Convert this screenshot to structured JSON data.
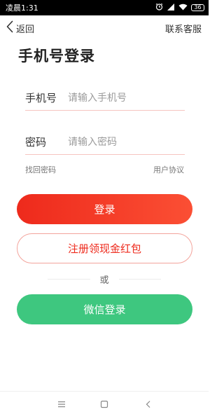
{
  "status_bar": {
    "time": "凌晨1:31",
    "battery": "36",
    "icons": [
      "alarm-icon",
      "signal-icon",
      "wifi-icon",
      "battery-icon"
    ]
  },
  "header": {
    "back_label": "返回",
    "service_label": "联系客服"
  },
  "title": "手机号登录",
  "form": {
    "phone_label": "手机号",
    "phone_placeholder": "请输入手机号",
    "phone_value": "",
    "password_label": "密码",
    "password_placeholder": "请输入密码",
    "password_value": ""
  },
  "links": {
    "forgot_password": "找回密码",
    "user_agreement": "用户协议"
  },
  "buttons": {
    "login": "登录",
    "register": "注册领现金红包",
    "divider": "或",
    "wechat_login": "微信登录"
  },
  "system_nav": [
    "menu-icon",
    "home-icon",
    "back-icon"
  ],
  "colors": {
    "accent_red": "#ee2a1c",
    "wechat_green": "#3ec77f",
    "field_underline": "#f6c4c0"
  }
}
